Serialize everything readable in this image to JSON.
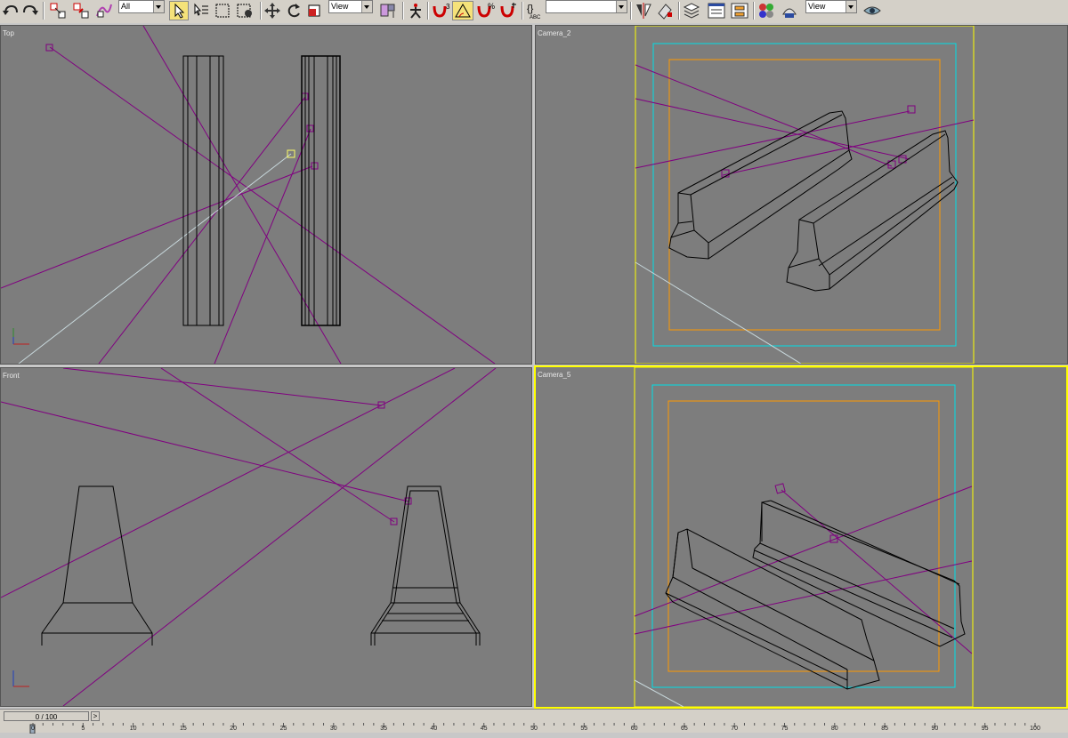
{
  "toolbar": {
    "selection_filter": "All",
    "ref_coord_1": "View",
    "named_selection": "",
    "ref_coord_2": "View",
    "snap_angle_label": "3"
  },
  "viewports": {
    "top": {
      "label": "Top"
    },
    "camera2": {
      "label": "Camera_2"
    },
    "front": {
      "label": "Front"
    },
    "camera5": {
      "label": "Camera_5"
    }
  },
  "timeline": {
    "frame_display": "0 / 100",
    "ticks": [
      "0",
      "5",
      "10",
      "15",
      "20",
      "25",
      "30",
      "35",
      "40",
      "45",
      "50",
      "55",
      "60",
      "65",
      "70",
      "75",
      "80",
      "85",
      "90",
      "95",
      "100"
    ]
  },
  "colors": {
    "viewport_bg": "#7d7d7d",
    "wire_object": "#000000",
    "light_lines": "#800080",
    "camera_selected": "#ffff66",
    "safe_frame_outer": "#ffff00",
    "safe_frame_action": "#00ffff",
    "safe_frame_title": "#ff9900",
    "active_border": "#ffff00"
  }
}
